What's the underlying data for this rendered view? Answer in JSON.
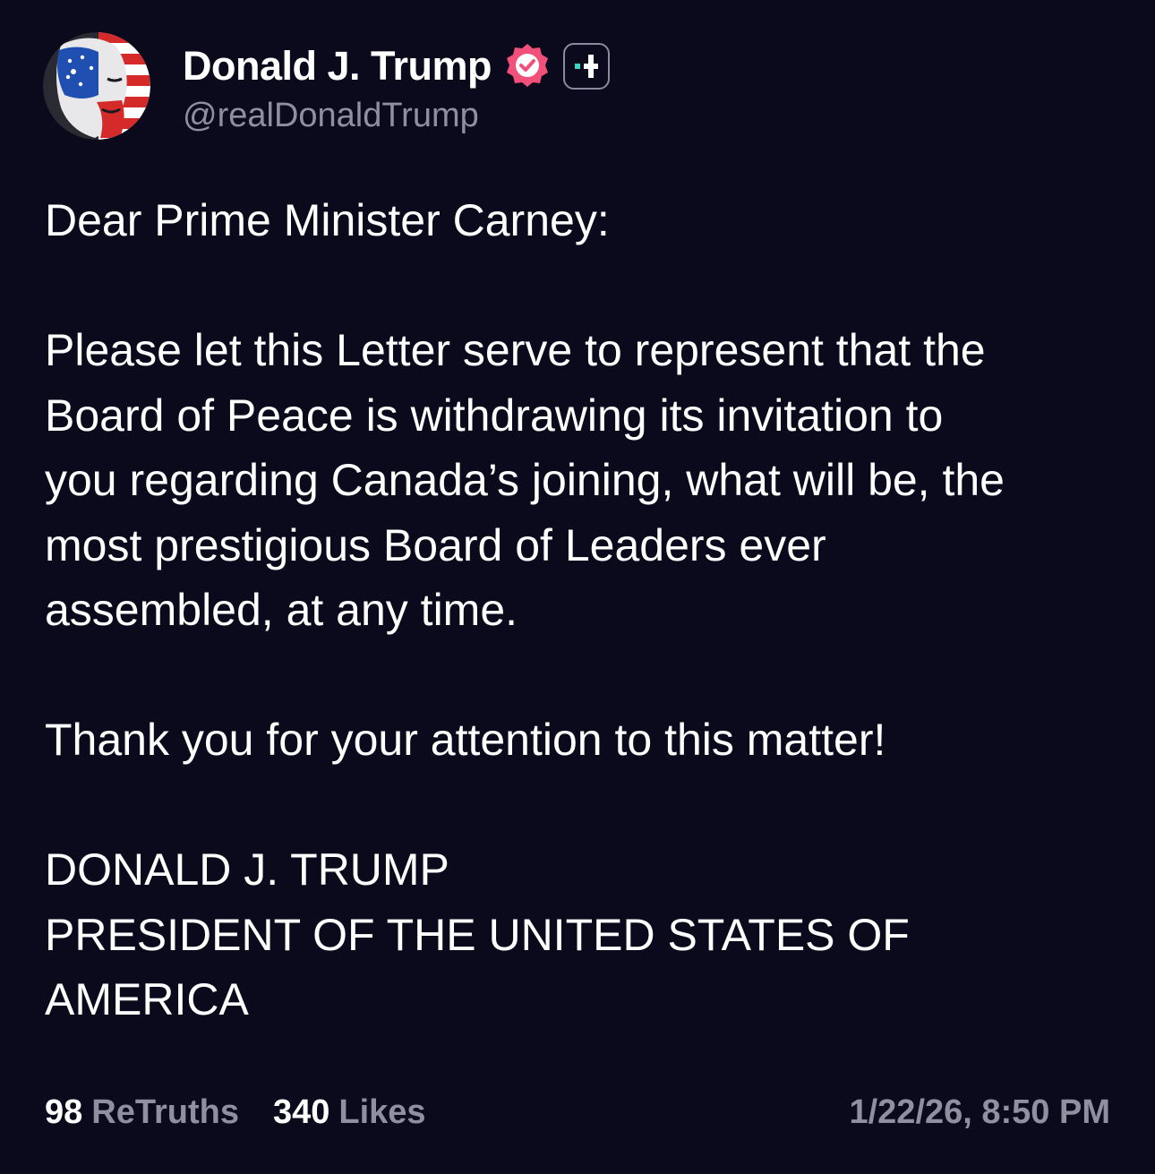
{
  "author": {
    "display_name": "Donald J. Trump",
    "handle": "@realDonaldTrump",
    "verified_icon": "verified-badge-icon",
    "plus_icon": "plus-badge-icon",
    "avatar": "profile-avatar"
  },
  "post": {
    "lines": [
      "Dear Prime Minister Carney:",
      "",
      "Please let this Letter serve to represent that the",
      "Board of Peace is withdrawing its invitation to",
      "you regarding Canada’s joining, what will be, the",
      "most prestigious Board of Leaders ever",
      "assembled, at any time.",
      "",
      "Thank you for your attention to this matter!",
      "",
      "DONALD J. TRUMP",
      "PRESIDENT OF THE UNITED STATES OF",
      "AMERICA"
    ]
  },
  "stats": {
    "retruths_count": "98",
    "retruths_label": "ReTruths",
    "likes_count": "340",
    "likes_label": "Likes",
    "timestamp": "1/22/26, 8:50 PM"
  },
  "colors": {
    "background": "#0a0a1c",
    "text": "#ffffff",
    "muted": "#8f8f9f",
    "verified": "#f0507a",
    "plus_accent": "#3ad6c4"
  }
}
